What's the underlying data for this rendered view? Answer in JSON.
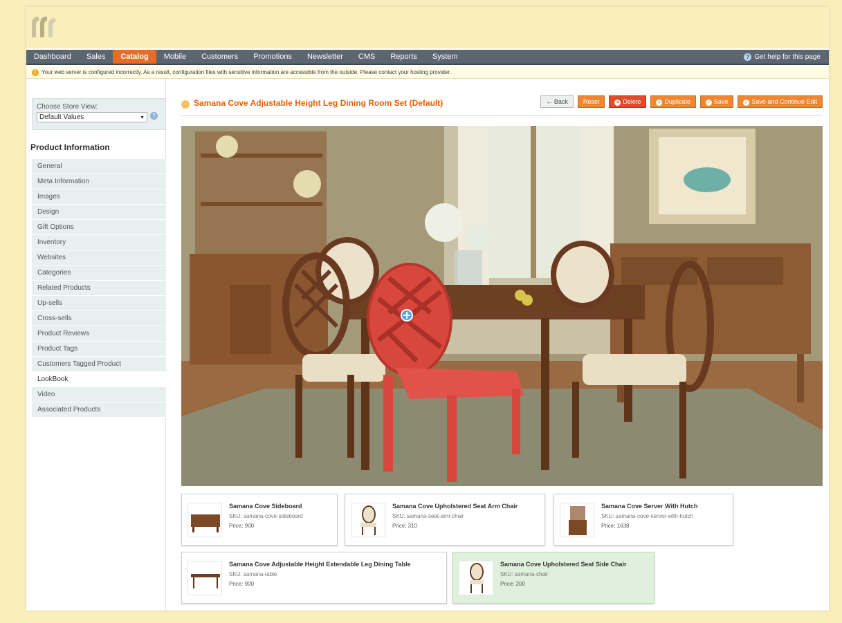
{
  "nav": {
    "items": [
      "Dashboard",
      "Sales",
      "Catalog",
      "Mobile",
      "Customers",
      "Promotions",
      "Newsletter",
      "CMS",
      "Reports",
      "System"
    ],
    "active": "Catalog",
    "help": "Get help for this page"
  },
  "notice": "Your web server is configured incorrectly. As a result, configuration files with sensitive information are accessible from the outside. Please contact your hosting provider.",
  "store": {
    "label": "Choose Store View:",
    "value": "Default Values"
  },
  "sidebar": {
    "title": "Product Information",
    "tabs": [
      "General",
      "Meta Information",
      "Images",
      "Design",
      "Gift Options",
      "Inventory",
      "Websites",
      "Categories",
      "Related Products",
      "Up-sells",
      "Cross-sells",
      "Product Reviews",
      "Product Tags",
      "Customers Tagged Product",
      "LookBook",
      "Video",
      "Associated Products"
    ],
    "active": "LookBook"
  },
  "page": {
    "title": "Samana Cove Adjustable Height Leg Dining Room Set (Default)"
  },
  "buttons": {
    "back": "Back",
    "reset": "Reset",
    "delete": "Delete",
    "duplicate": "Duplicate",
    "save": "Save",
    "save_continue": "Save and Continue Edit"
  },
  "products": [
    {
      "name": "Samana Cove Sideboard",
      "sku": "SKU: samana-cove-sideboard",
      "price": "Price: 900",
      "thumb": "sideboard"
    },
    {
      "name": "Samana Cove Upholstered Seat Arm Chair",
      "sku": "SKU: samana-seat-arm-chair",
      "price": "Price: 310",
      "thumb": "armchair"
    },
    {
      "name": "Samana Cove Server With Hutch",
      "sku": "SKU: samana-cove-server-with-hutch",
      "price": "Price: 1638",
      "thumb": "hutch"
    },
    {
      "name": "Samana Cove Adjustable Height Extendable Leg Dining Table",
      "sku": "SKU: samana-table",
      "price": "Price: 900",
      "thumb": "table"
    },
    {
      "name": "Samana Cove Upholstered Seat Side Chair",
      "sku": "SKU: samana-chair",
      "price": "Price: 200",
      "thumb": "sidechair",
      "selected": true
    }
  ],
  "colors": {
    "accent": "#eb5e00",
    "nav": "#5c6670",
    "selected_chair": "#d8473c"
  }
}
